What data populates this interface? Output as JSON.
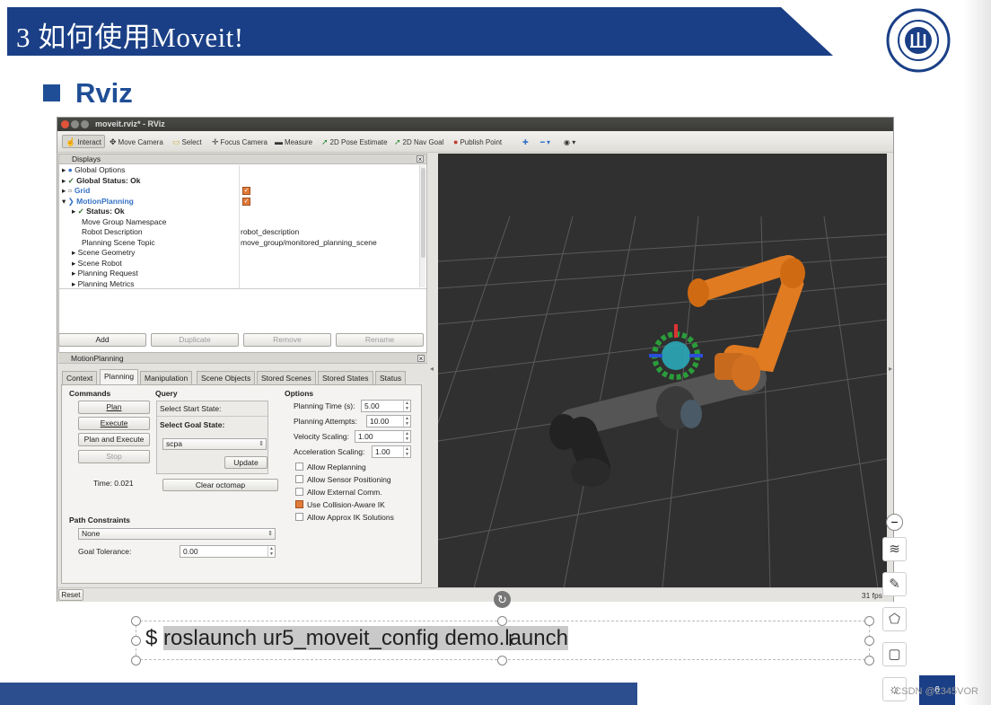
{
  "slide": {
    "title": "3 如何使用Moveit!",
    "subtitle": "Rviz",
    "banner_color": "#1a3f86",
    "accent_color": "#1f4e96"
  },
  "rviz": {
    "window_title": "moveit.rviz* - RViz",
    "toolbar": [
      "Interact",
      "Move Camera",
      "Select",
      "Focus Camera",
      "Measure",
      "2D Pose Estimate",
      "2D Nav Goal",
      "Publish Point"
    ],
    "displays": {
      "title": "Displays",
      "rows": [
        {
          "label": "Global Options",
          "value": ""
        },
        {
          "label": "Global Status: Ok",
          "value": ""
        },
        {
          "label": "Grid",
          "value": ""
        },
        {
          "label": "MotionPlanning",
          "value": ""
        },
        {
          "label": "Status: Ok",
          "value": ""
        },
        {
          "label": "Move Group Namespace",
          "value": ""
        },
        {
          "label": "Robot Description",
          "value": "robot_description"
        },
        {
          "label": "Planning Scene Topic",
          "value": "move_group/monitored_planning_scene"
        },
        {
          "label": "Scene Geometry",
          "value": ""
        },
        {
          "label": "Scene Robot",
          "value": ""
        },
        {
          "label": "Planning Request",
          "value": ""
        },
        {
          "label": "Planning Metrics",
          "value": ""
        }
      ],
      "buttons": [
        "Add",
        "Duplicate",
        "Remove",
        "Rename"
      ]
    },
    "motion_planning": {
      "title": "MotionPlanning",
      "tabs": [
        "Context",
        "Planning",
        "Manipulation",
        "Scene Objects",
        "Stored Scenes",
        "Stored States",
        "Status"
      ],
      "commands_label": "Commands",
      "commands": [
        "Plan",
        "Execute",
        "Plan and Execute",
        "Stop"
      ],
      "time_label": "Time: 0.021",
      "query_label": "Query",
      "select_start": "Select Start State:",
      "select_goal": "Select Goal State:",
      "goal_state": "scpa",
      "update": "Update",
      "clear_octomap": "Clear octomap",
      "options_label": "Options",
      "options": [
        {
          "label": "Planning Time (s):",
          "value": "5.00"
        },
        {
          "label": "Planning Attempts:",
          "value": "10.00"
        },
        {
          "label": "Velocity Scaling:",
          "value": "1.00"
        },
        {
          "label": "Acceleration Scaling:",
          "value": "1.00"
        }
      ],
      "checkboxes": [
        {
          "label": "Allow Replanning",
          "checked": false
        },
        {
          "label": "Allow Sensor Positioning",
          "checked": false
        },
        {
          "label": "Allow External Comm.",
          "checked": false
        },
        {
          "label": "Use Collision-Aware IK",
          "checked": true
        },
        {
          "label": "Allow Approx IK Solutions",
          "checked": false
        }
      ],
      "path_constraints_label": "Path Constraints",
      "path_constraints_value": "None",
      "goal_tolerance_label": "Goal Tolerance:",
      "goal_tolerance_value": "0.00"
    },
    "reset": "Reset",
    "fps": "31 fps",
    "robot_color": "#e07b22"
  },
  "command": {
    "prompt": "$",
    "text": "roslaunch ur5_moveit_config demo.launch"
  },
  "watermark": "CSDN @2345VOR",
  "page_number": "6"
}
